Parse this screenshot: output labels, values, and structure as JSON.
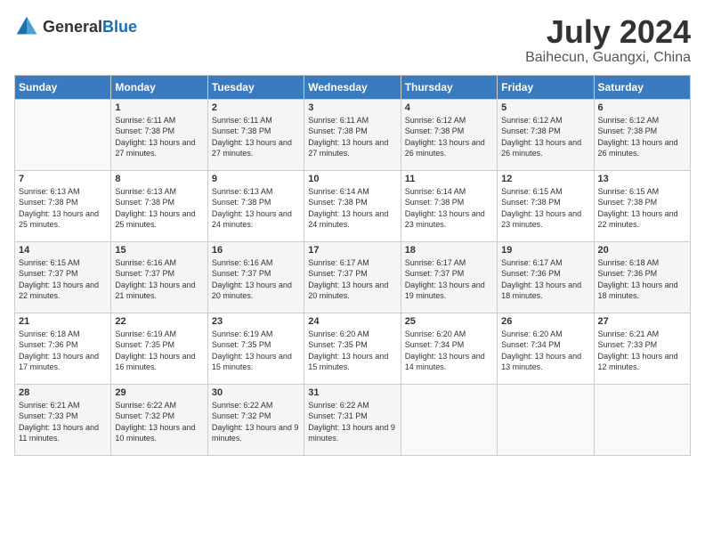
{
  "logo": {
    "text_general": "General",
    "text_blue": "Blue"
  },
  "title": {
    "month_year": "July 2024",
    "location": "Baihecun, Guangxi, China"
  },
  "weekdays": [
    "Sunday",
    "Monday",
    "Tuesday",
    "Wednesday",
    "Thursday",
    "Friday",
    "Saturday"
  ],
  "weeks": [
    [
      {
        "day": "",
        "sunrise": "",
        "sunset": "",
        "daylight": ""
      },
      {
        "day": "1",
        "sunrise": "Sunrise: 6:11 AM",
        "sunset": "Sunset: 7:38 PM",
        "daylight": "Daylight: 13 hours and 27 minutes."
      },
      {
        "day": "2",
        "sunrise": "Sunrise: 6:11 AM",
        "sunset": "Sunset: 7:38 PM",
        "daylight": "Daylight: 13 hours and 27 minutes."
      },
      {
        "day": "3",
        "sunrise": "Sunrise: 6:11 AM",
        "sunset": "Sunset: 7:38 PM",
        "daylight": "Daylight: 13 hours and 27 minutes."
      },
      {
        "day": "4",
        "sunrise": "Sunrise: 6:12 AM",
        "sunset": "Sunset: 7:38 PM",
        "daylight": "Daylight: 13 hours and 26 minutes."
      },
      {
        "day": "5",
        "sunrise": "Sunrise: 6:12 AM",
        "sunset": "Sunset: 7:38 PM",
        "daylight": "Daylight: 13 hours and 26 minutes."
      },
      {
        "day": "6",
        "sunrise": "Sunrise: 6:12 AM",
        "sunset": "Sunset: 7:38 PM",
        "daylight": "Daylight: 13 hours and 26 minutes."
      }
    ],
    [
      {
        "day": "7",
        "sunrise": "Sunrise: 6:13 AM",
        "sunset": "Sunset: 7:38 PM",
        "daylight": "Daylight: 13 hours and 25 minutes."
      },
      {
        "day": "8",
        "sunrise": "Sunrise: 6:13 AM",
        "sunset": "Sunset: 7:38 PM",
        "daylight": "Daylight: 13 hours and 25 minutes."
      },
      {
        "day": "9",
        "sunrise": "Sunrise: 6:13 AM",
        "sunset": "Sunset: 7:38 PM",
        "daylight": "Daylight: 13 hours and 24 minutes."
      },
      {
        "day": "10",
        "sunrise": "Sunrise: 6:14 AM",
        "sunset": "Sunset: 7:38 PM",
        "daylight": "Daylight: 13 hours and 24 minutes."
      },
      {
        "day": "11",
        "sunrise": "Sunrise: 6:14 AM",
        "sunset": "Sunset: 7:38 PM",
        "daylight": "Daylight: 13 hours and 23 minutes."
      },
      {
        "day": "12",
        "sunrise": "Sunrise: 6:15 AM",
        "sunset": "Sunset: 7:38 PM",
        "daylight": "Daylight: 13 hours and 23 minutes."
      },
      {
        "day": "13",
        "sunrise": "Sunrise: 6:15 AM",
        "sunset": "Sunset: 7:38 PM",
        "daylight": "Daylight: 13 hours and 22 minutes."
      }
    ],
    [
      {
        "day": "14",
        "sunrise": "Sunrise: 6:15 AM",
        "sunset": "Sunset: 7:37 PM",
        "daylight": "Daylight: 13 hours and 22 minutes."
      },
      {
        "day": "15",
        "sunrise": "Sunrise: 6:16 AM",
        "sunset": "Sunset: 7:37 PM",
        "daylight": "Daylight: 13 hours and 21 minutes."
      },
      {
        "day": "16",
        "sunrise": "Sunrise: 6:16 AM",
        "sunset": "Sunset: 7:37 PM",
        "daylight": "Daylight: 13 hours and 20 minutes."
      },
      {
        "day": "17",
        "sunrise": "Sunrise: 6:17 AM",
        "sunset": "Sunset: 7:37 PM",
        "daylight": "Daylight: 13 hours and 20 minutes."
      },
      {
        "day": "18",
        "sunrise": "Sunrise: 6:17 AM",
        "sunset": "Sunset: 7:37 PM",
        "daylight": "Daylight: 13 hours and 19 minutes."
      },
      {
        "day": "19",
        "sunrise": "Sunrise: 6:17 AM",
        "sunset": "Sunset: 7:36 PM",
        "daylight": "Daylight: 13 hours and 18 minutes."
      },
      {
        "day": "20",
        "sunrise": "Sunrise: 6:18 AM",
        "sunset": "Sunset: 7:36 PM",
        "daylight": "Daylight: 13 hours and 18 minutes."
      }
    ],
    [
      {
        "day": "21",
        "sunrise": "Sunrise: 6:18 AM",
        "sunset": "Sunset: 7:36 PM",
        "daylight": "Daylight: 13 hours and 17 minutes."
      },
      {
        "day": "22",
        "sunrise": "Sunrise: 6:19 AM",
        "sunset": "Sunset: 7:35 PM",
        "daylight": "Daylight: 13 hours and 16 minutes."
      },
      {
        "day": "23",
        "sunrise": "Sunrise: 6:19 AM",
        "sunset": "Sunset: 7:35 PM",
        "daylight": "Daylight: 13 hours and 15 minutes."
      },
      {
        "day": "24",
        "sunrise": "Sunrise: 6:20 AM",
        "sunset": "Sunset: 7:35 PM",
        "daylight": "Daylight: 13 hours and 15 minutes."
      },
      {
        "day": "25",
        "sunrise": "Sunrise: 6:20 AM",
        "sunset": "Sunset: 7:34 PM",
        "daylight": "Daylight: 13 hours and 14 minutes."
      },
      {
        "day": "26",
        "sunrise": "Sunrise: 6:20 AM",
        "sunset": "Sunset: 7:34 PM",
        "daylight": "Daylight: 13 hours and 13 minutes."
      },
      {
        "day": "27",
        "sunrise": "Sunrise: 6:21 AM",
        "sunset": "Sunset: 7:33 PM",
        "daylight": "Daylight: 13 hours and 12 minutes."
      }
    ],
    [
      {
        "day": "28",
        "sunrise": "Sunrise: 6:21 AM",
        "sunset": "Sunset: 7:33 PM",
        "daylight": "Daylight: 13 hours and 11 minutes."
      },
      {
        "day": "29",
        "sunrise": "Sunrise: 6:22 AM",
        "sunset": "Sunset: 7:32 PM",
        "daylight": "Daylight: 13 hours and 10 minutes."
      },
      {
        "day": "30",
        "sunrise": "Sunrise: 6:22 AM",
        "sunset": "Sunset: 7:32 PM",
        "daylight": "Daylight: 13 hours and 9 minutes."
      },
      {
        "day": "31",
        "sunrise": "Sunrise: 6:22 AM",
        "sunset": "Sunset: 7:31 PM",
        "daylight": "Daylight: 13 hours and 9 minutes."
      },
      {
        "day": "",
        "sunrise": "",
        "sunset": "",
        "daylight": ""
      },
      {
        "day": "",
        "sunrise": "",
        "sunset": "",
        "daylight": ""
      },
      {
        "day": "",
        "sunrise": "",
        "sunset": "",
        "daylight": ""
      }
    ]
  ]
}
